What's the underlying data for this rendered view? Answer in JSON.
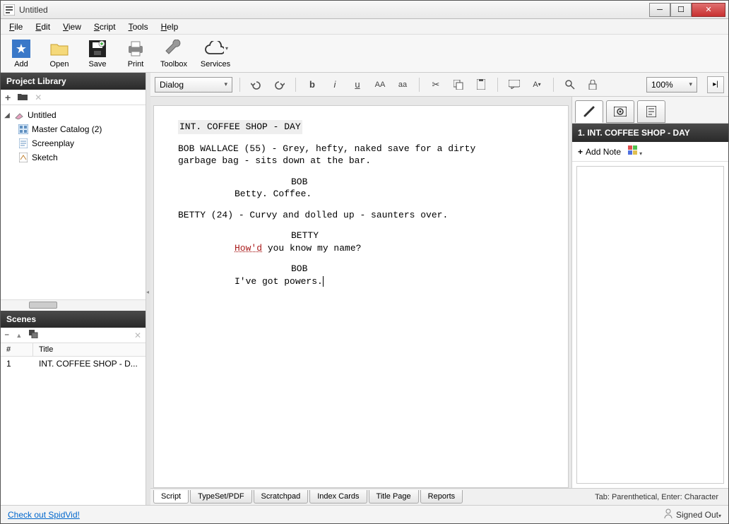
{
  "window": {
    "title": "Untitled"
  },
  "menu": {
    "file": "File",
    "edit": "Edit",
    "view": "View",
    "script": "Script",
    "tools": "Tools",
    "help": "Help"
  },
  "toolbar": {
    "add": "Add",
    "open": "Open",
    "save": "Save",
    "print": "Print",
    "toolbox": "Toolbox",
    "services": "Services"
  },
  "format": {
    "element": "Dialog",
    "zoom": "100%"
  },
  "left": {
    "library_title": "Project Library",
    "tree": {
      "root": "Untitled",
      "items": [
        "Master Catalog (2)",
        "Screenplay",
        "Sketch"
      ]
    },
    "scenes_title": "Scenes",
    "scenes_hdr_num": "#",
    "scenes_hdr_title": "Title",
    "scenes": [
      {
        "num": "1",
        "title": "INT. COFFEE SHOP - D..."
      }
    ]
  },
  "script": {
    "slug": "INT. COFFEE SHOP - DAY",
    "action1a": "BOB WALLACE (55) - Grey, hefty, naked save for a dirty",
    "action1b": "garbage bag - sits down at the bar.",
    "char1": "BOB",
    "line1": "Betty.  Coffee.",
    "action2": "BETTY (24) - Curvy and dolled up - saunters over.",
    "char2": "BETTY",
    "line2a": "How'd",
    "line2b": " you know my name?",
    "char3": "BOB",
    "line3": "I've got powers."
  },
  "right": {
    "scene_title": "1. INT. COFFEE SHOP - DAY",
    "add_note": "Add Note"
  },
  "tabs": {
    "script": "Script",
    "typeset": "TypeSet/PDF",
    "scratchpad": "Scratchpad",
    "index": "Index Cards",
    "titlepage": "Title Page",
    "reports": "Reports"
  },
  "hint": "Tab: Parenthetical, Enter: Character",
  "status": {
    "link": "Check out SpidVid!",
    "signed": "Signed Out"
  }
}
